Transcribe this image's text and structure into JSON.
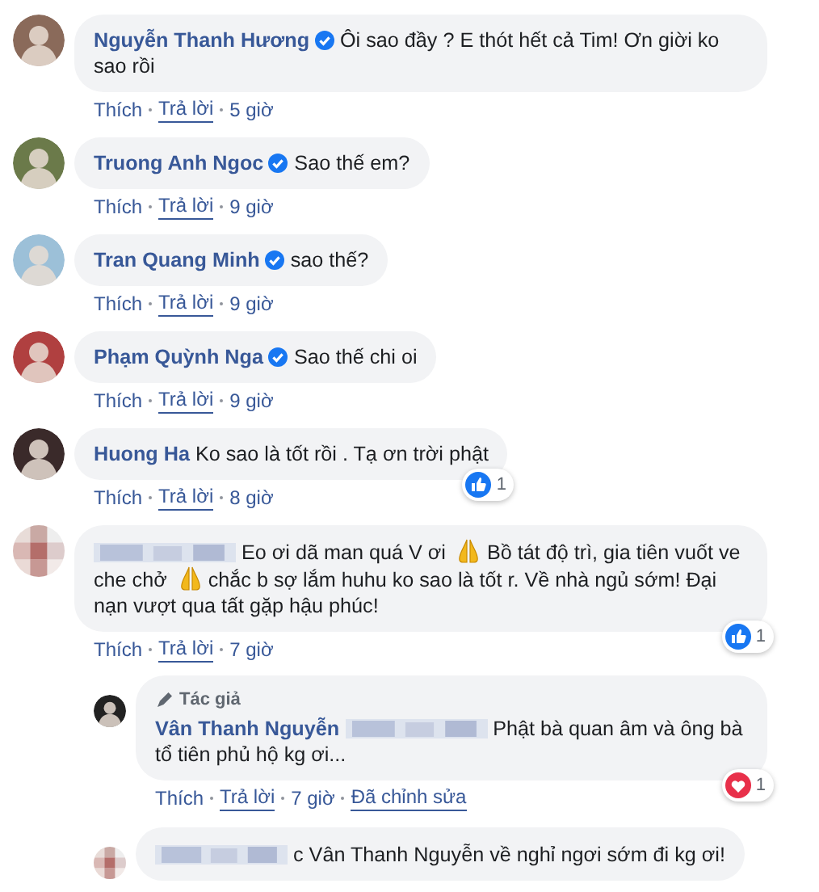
{
  "comments": [
    {
      "author": {
        "name": "Nguyễn Thanh Hương",
        "verified": true
      },
      "parts": [
        {
          "kind": "text",
          "text": "Ôi sao đầy ? E thót hết cả Tim! Ơn giời ko sao rồi"
        }
      ],
      "actions": {
        "like": "Thích",
        "reply": "Trả lời",
        "time": "5 giờ"
      }
    },
    {
      "author": {
        "name": "Truong Anh Ngoc",
        "verified": true
      },
      "parts": [
        {
          "kind": "text",
          "text": "Sao thế em?"
        }
      ],
      "actions": {
        "like": "Thích",
        "reply": "Trả lời",
        "time": "9 giờ"
      }
    },
    {
      "author": {
        "name": "Tran Quang Minh",
        "verified": true
      },
      "parts": [
        {
          "kind": "text",
          "text": "sao thế?"
        }
      ],
      "actions": {
        "like": "Thích",
        "reply": "Trả lời",
        "time": "9 giờ"
      }
    },
    {
      "author": {
        "name": "Phạm Quỳnh Nga",
        "verified": true
      },
      "parts": [
        {
          "kind": "text",
          "text": "Sao thế chi oi"
        }
      ],
      "actions": {
        "like": "Thích",
        "reply": "Trả lời",
        "time": "9 giờ"
      }
    },
    {
      "author": {
        "name": "Huong Ha",
        "verified": false
      },
      "parts": [
        {
          "kind": "text",
          "text": "Ko sao là tốt rồi . Tạ ơn trời phật"
        }
      ],
      "actions": {
        "like": "Thích",
        "reply": "Trả lời",
        "time": "8 giờ"
      },
      "reaction": {
        "kind": "like",
        "count": "1"
      }
    },
    {
      "author": {
        "hidden": true
      },
      "parts": [
        {
          "kind": "text",
          "text": "Eo ơi dã man quá V ơi"
        },
        {
          "kind": "emoji"
        },
        {
          "kind": "text",
          "text": "Bồ tát độ trì, gia tiên vuốt ve che chở"
        },
        {
          "kind": "emoji"
        },
        {
          "kind": "text",
          "text": "chắc b sợ lắm huhu ko sao là tốt r. Về nhà ngủ sớm! Đại nạn vượt qua tất gặp hậu phúc!"
        }
      ],
      "actions": {
        "like": "Thích",
        "reply": "Trả lời",
        "time": "7 giờ"
      },
      "reaction": {
        "kind": "like",
        "count": "1"
      },
      "replies": [
        {
          "author": {
            "name": "Vân Thanh Nguyễn",
            "verified": false,
            "badge": "Tác giả"
          },
          "parts": [
            {
              "kind": "mention"
            },
            {
              "kind": "text",
              "text": "Phật bà quan âm và ông bà tổ tiên phủ hộ kg ơi..."
            }
          ],
          "actions": {
            "like": "Thích",
            "reply": "Trả lời",
            "time": "7 giờ",
            "edited": "Đã chỉnh sửa"
          },
          "reaction": {
            "kind": "love",
            "count": "1"
          }
        },
        {
          "author": {
            "hidden": true
          },
          "parts": [
            {
              "kind": "text",
              "text": "c Vân Thanh Nguyễn về nghỉ ngơi sớm đi kg ơi!"
            }
          ]
        }
      ]
    }
  ]
}
